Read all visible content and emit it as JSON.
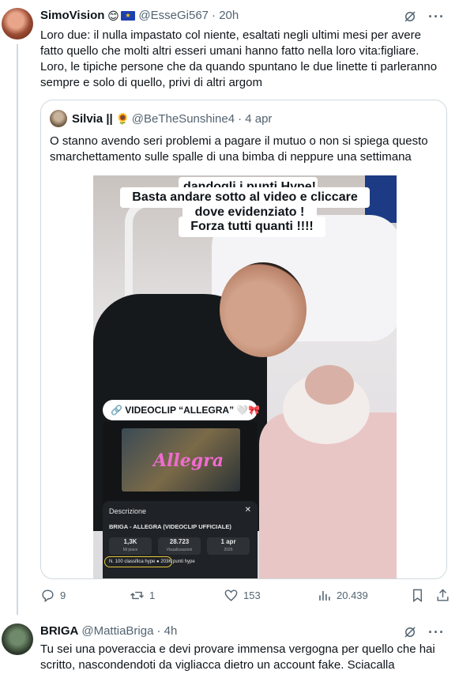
{
  "tweet1": {
    "name": "SimoVision",
    "handle": "@EsseGi567",
    "time": "· 20h",
    "text": "Loro due: il nulla impastato col niente, esaltati negli ultimi mesi per avere fatto quello che molti altri esseri umani hanno fatto nella loro vita:figliare. Loro, le tipiche persone che da quando spuntano le due linette ti parleranno sempre e solo di quello, privi di altri argom"
  },
  "quote": {
    "name": "Silvia ||",
    "handle": "@BeTheSunshine4",
    "time": "· 4 apr",
    "text": "O stanno avendo seri problemi a pagare il mutuo o non si spiega questo smarchettamento sulle spalle di una bimba di neppure una settimana",
    "image": {
      "banner1": "dandogli i punti Hype!",
      "banner2": "Basta andare sotto al video e cliccare",
      "banner3": "dove evidenziato !",
      "banner4": "Forza tutti quanti !!!!",
      "videoclip_label": "VIDEOCLIP “ALLEGRA” 🤍🎀",
      "thumb_title": "Allegra",
      "desc_title": "Descrizione",
      "desc_close": "✕",
      "song_title": "BRIGA - ALLEGRA (VIDEOCLIP UFFICIALE)",
      "stats": [
        {
          "value": "1,3K",
          "label": "Mi piace"
        },
        {
          "value": "28.723",
          "label": "Visualizzazioni"
        },
        {
          "value": "1 apr",
          "label": "2026"
        }
      ],
      "hype_text": "N. 100 classifica hype   ● 203K punti hype"
    }
  },
  "actions": {
    "replies": "9",
    "reposts": "1",
    "likes": "153",
    "views": "20.439"
  },
  "tweet2": {
    "name": "BRIGA",
    "handle": "@MattiaBriga",
    "time": "· 4h",
    "text": "Tu sei una poveraccia e devi provare immensa vergogna per quello che hai scritto, nascondendoti da vigliacca dietro un account fake. Sciacalla"
  },
  "colors": {
    "muted": "#536471",
    "border": "#cfd9de",
    "text": "#0f1419"
  }
}
